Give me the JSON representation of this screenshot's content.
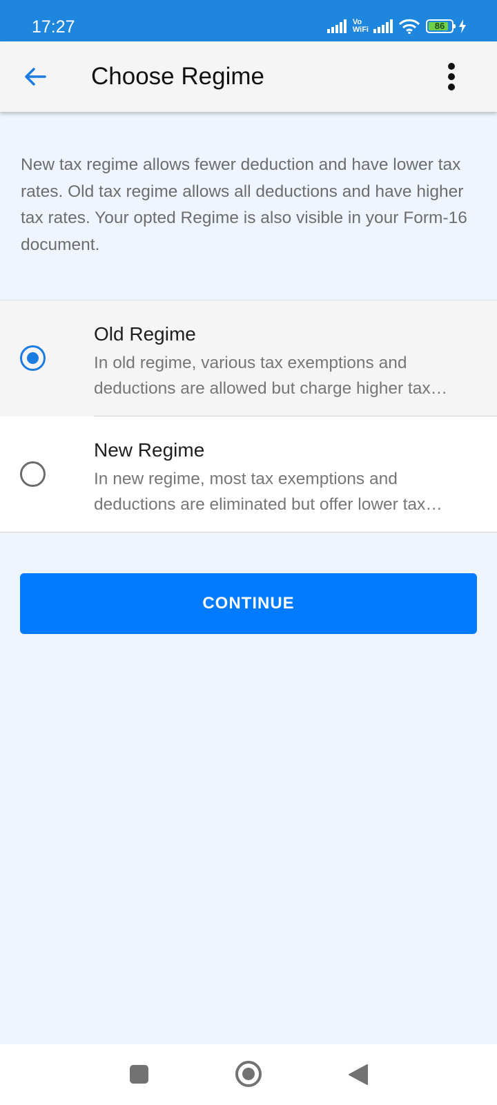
{
  "status_bar": {
    "time": "17:27",
    "network_vo": "Vo",
    "network_wifi": "WiFi",
    "battery_level": "86",
    "battery_fraction": 0.86,
    "icons": [
      "signal-icon",
      "vowifi-icon",
      "signal-icon",
      "wifi-icon",
      "battery-icon",
      "charging-icon"
    ]
  },
  "app_bar": {
    "title": "Choose Regime",
    "back_icon": "arrow-left-icon",
    "menu_icon": "more-vertical-icon"
  },
  "description": "New tax regime allows fewer deduction and have lower tax rates. Old tax regime allows all deductions and have higher tax rates. Your opted Regime is also visible in your Form-16 document.",
  "regimes": [
    {
      "title": "Old Regime",
      "description": "In old regime, various tax exemptions and deductions are allowed but charge higher tax rates.",
      "selected": true
    },
    {
      "title": "New Regime",
      "description": "In new regime, most tax exemptions and deductions are eliminated but offer lower tax rates.",
      "selected": false
    }
  ],
  "continue_label": "CONTINUE",
  "colors": {
    "status_bar": "#1f86de",
    "accent": "#1a7be0",
    "button": "#007bff",
    "background": "#eef5fe"
  },
  "nav_bar": {
    "icons": [
      "recents-icon",
      "home-icon",
      "back-icon"
    ]
  }
}
